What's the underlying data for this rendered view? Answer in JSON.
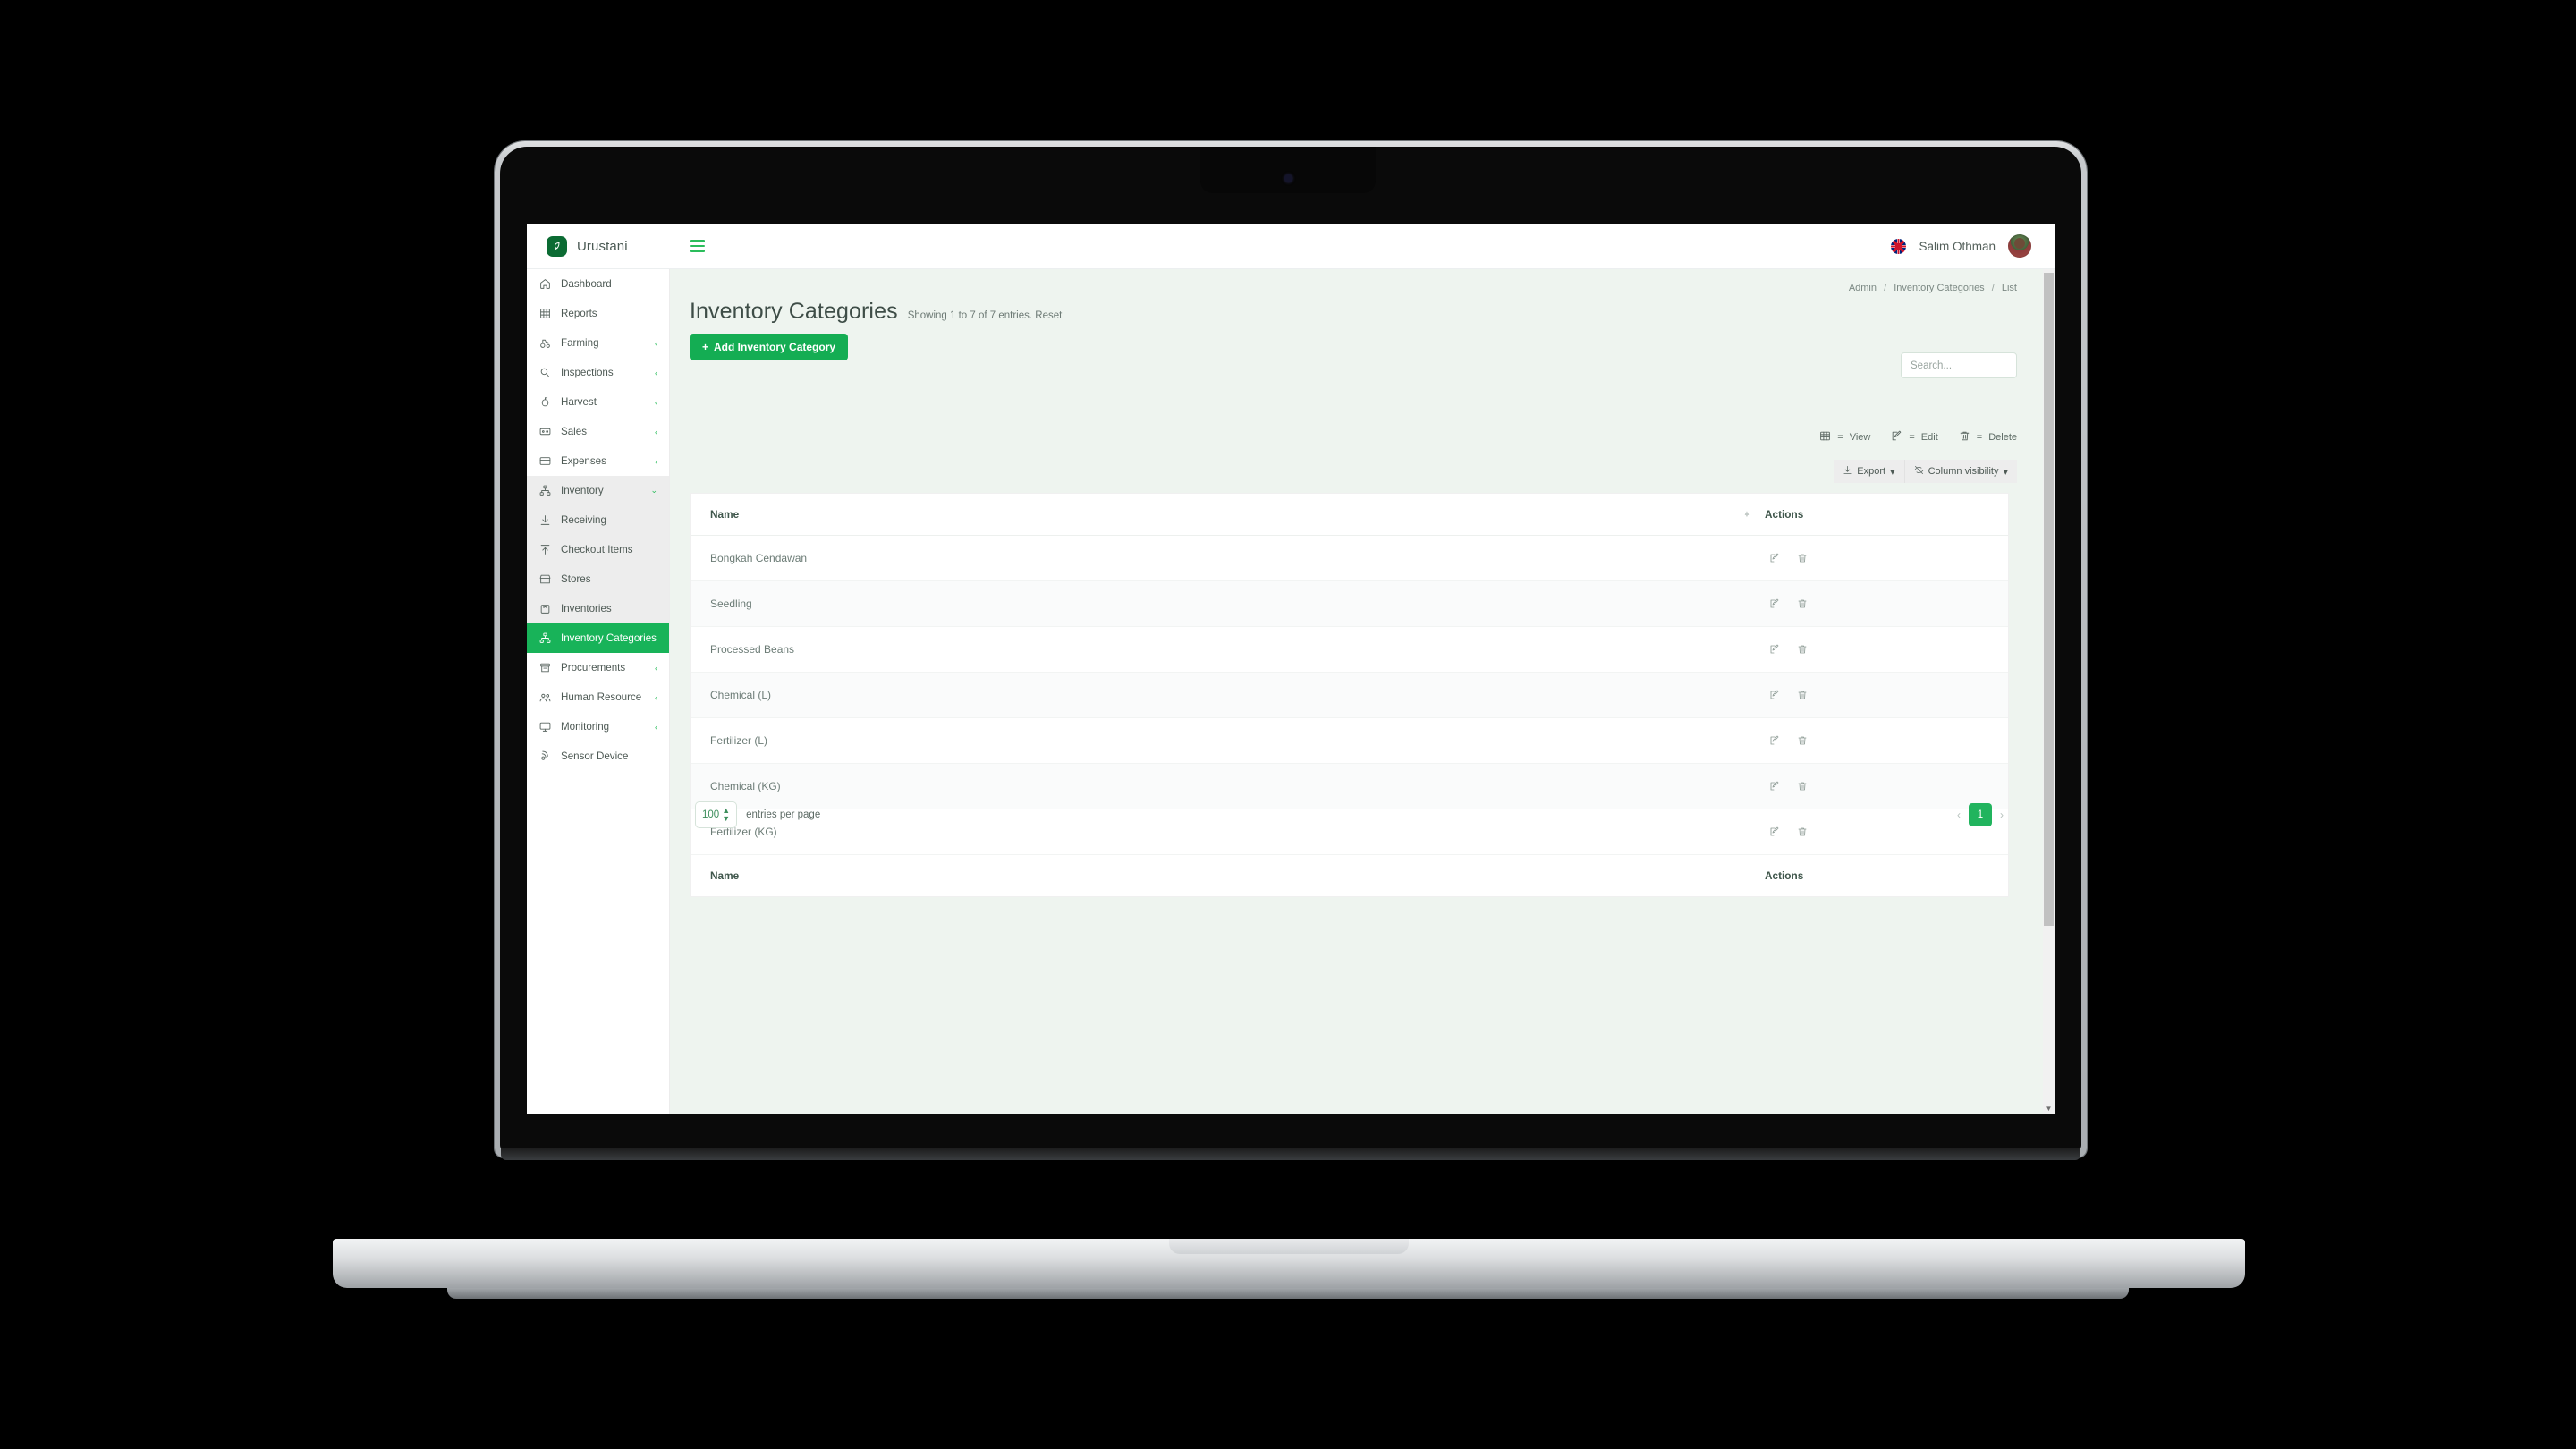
{
  "brand": {
    "name": "Urustani",
    "logo_glyph": "⚘"
  },
  "topbar": {
    "menu_toggle": "hamburger-menu",
    "language_flag": "uk-flag",
    "username": "Salim Othman"
  },
  "sidebar": {
    "items": [
      {
        "label": "Dashboard",
        "icon": "home-icon",
        "caret": "",
        "state": "normal"
      },
      {
        "label": "Reports",
        "icon": "grid-icon",
        "caret": "",
        "state": "normal"
      },
      {
        "label": "Farming",
        "icon": "tractor-icon",
        "caret": "‹",
        "state": "normal"
      },
      {
        "label": "Inspections",
        "icon": "search-icon",
        "caret": "‹",
        "state": "normal"
      },
      {
        "label": "Harvest",
        "icon": "apple-icon",
        "caret": "‹",
        "state": "normal"
      },
      {
        "label": "Sales",
        "icon": "cash-icon",
        "caret": "‹",
        "state": "normal"
      },
      {
        "label": "Expenses",
        "icon": "card-icon",
        "caret": "‹",
        "state": "normal"
      },
      {
        "label": "Inventory",
        "icon": "sitemap-icon",
        "caret": "⌄",
        "state": "group-open"
      },
      {
        "label": "Receiving",
        "icon": "download-icon",
        "caret": "",
        "state": "sub"
      },
      {
        "label": "Checkout Items",
        "icon": "upload-icon",
        "caret": "",
        "state": "sub"
      },
      {
        "label": "Stores",
        "icon": "store-icon",
        "caret": "",
        "state": "sub"
      },
      {
        "label": "Inventories",
        "icon": "box-icon",
        "caret": "",
        "state": "sub"
      },
      {
        "label": "Inventory Categories",
        "icon": "sitemap-icon",
        "caret": "",
        "state": "active"
      },
      {
        "label": "Procurements",
        "icon": "archive-icon",
        "caret": "‹",
        "state": "normal"
      },
      {
        "label": "Human Resource",
        "icon": "people-icon",
        "caret": "‹",
        "state": "normal"
      },
      {
        "label": "Monitoring",
        "icon": "monitor-icon",
        "caret": "‹",
        "state": "normal"
      },
      {
        "label": "Sensor Device",
        "icon": "sensor-icon",
        "caret": "",
        "state": "normal"
      }
    ]
  },
  "breadcrumb": {
    "items": [
      "Admin",
      "Inventory Categories",
      "List"
    ],
    "separator": "/"
  },
  "page": {
    "title": "Inventory Categories",
    "showing": "Showing 1 to 7 of 7 entries.",
    "reset_label": "Reset",
    "add_button": "Add Inventory Category",
    "add_button_plus": "+"
  },
  "search": {
    "placeholder": "Search...",
    "value": ""
  },
  "legend": [
    {
      "icon": "table-icon",
      "eq": "=",
      "label": "View"
    },
    {
      "icon": "edit-icon",
      "eq": "=",
      "label": "Edit"
    },
    {
      "icon": "trash-icon",
      "eq": "=",
      "label": "Delete"
    }
  ],
  "table_buttons": [
    {
      "label": "Export",
      "icon": "download-icon",
      "caret": "▾"
    },
    {
      "label": "Column visibility",
      "icon": "eye-slash-icon",
      "caret": "▾"
    }
  ],
  "table": {
    "columns": [
      "Name",
      "Actions"
    ],
    "rows": [
      {
        "name": "Bongkah Cendawan"
      },
      {
        "name": "Seedling"
      },
      {
        "name": "Processed Beans"
      },
      {
        "name": "Chemical (L)"
      },
      {
        "name": "Fertilizer (L)"
      },
      {
        "name": "Chemical (KG)"
      },
      {
        "name": "Fertilizer (KG)"
      }
    ],
    "row_actions": [
      {
        "icon": "edit-icon",
        "title": "Edit"
      },
      {
        "icon": "trash-icon",
        "title": "Delete"
      }
    ]
  },
  "pagination": {
    "per_page_value": "100",
    "per_page_label": "entries per page",
    "prev": "‹",
    "next": "›",
    "current_page": "1"
  },
  "colors": {
    "brand_green": "#0b6b33",
    "accent_green": "#14ad53",
    "active_green": "#18b359",
    "page_bg": "#eef4ef",
    "card_bg": "#ffffff"
  }
}
